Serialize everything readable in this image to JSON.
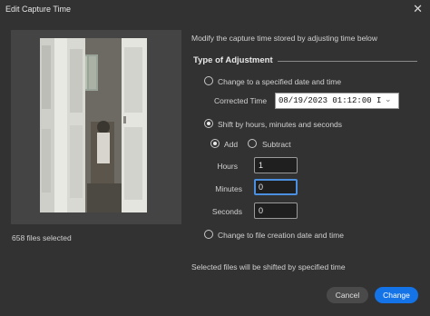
{
  "dialog": {
    "title": "Edit Capture Time",
    "close_glyph": "✕"
  },
  "preview": {
    "files_selected": "658 files selected"
  },
  "description": "Modify the capture time stored by adjusting time below",
  "section_title": "Type of Adjustment",
  "options": {
    "specified_date": {
      "label": "Change to a specified date and time",
      "checked": false
    },
    "corrected_time": {
      "label": "Corrected Time",
      "value": "08/19/2023  01:12:00 I"
    },
    "shift": {
      "label": "Shift by hours, minutes and seconds",
      "checked": true
    },
    "add": {
      "label": "Add",
      "checked": true
    },
    "subtract": {
      "label": "Subtract",
      "checked": false
    },
    "hours": {
      "label": "Hours",
      "value": "1"
    },
    "minutes": {
      "label": "Minutes",
      "value": "0"
    },
    "seconds": {
      "label": "Seconds",
      "value": "0"
    },
    "file_creation": {
      "label": "Change to file creation date and time",
      "checked": false
    }
  },
  "note": "Selected files will be shifted by specified time",
  "buttons": {
    "cancel": "Cancel",
    "change": "Change"
  },
  "colors": {
    "background": "#323232",
    "accent": "#1473e6",
    "focus": "#4a8fe0"
  }
}
